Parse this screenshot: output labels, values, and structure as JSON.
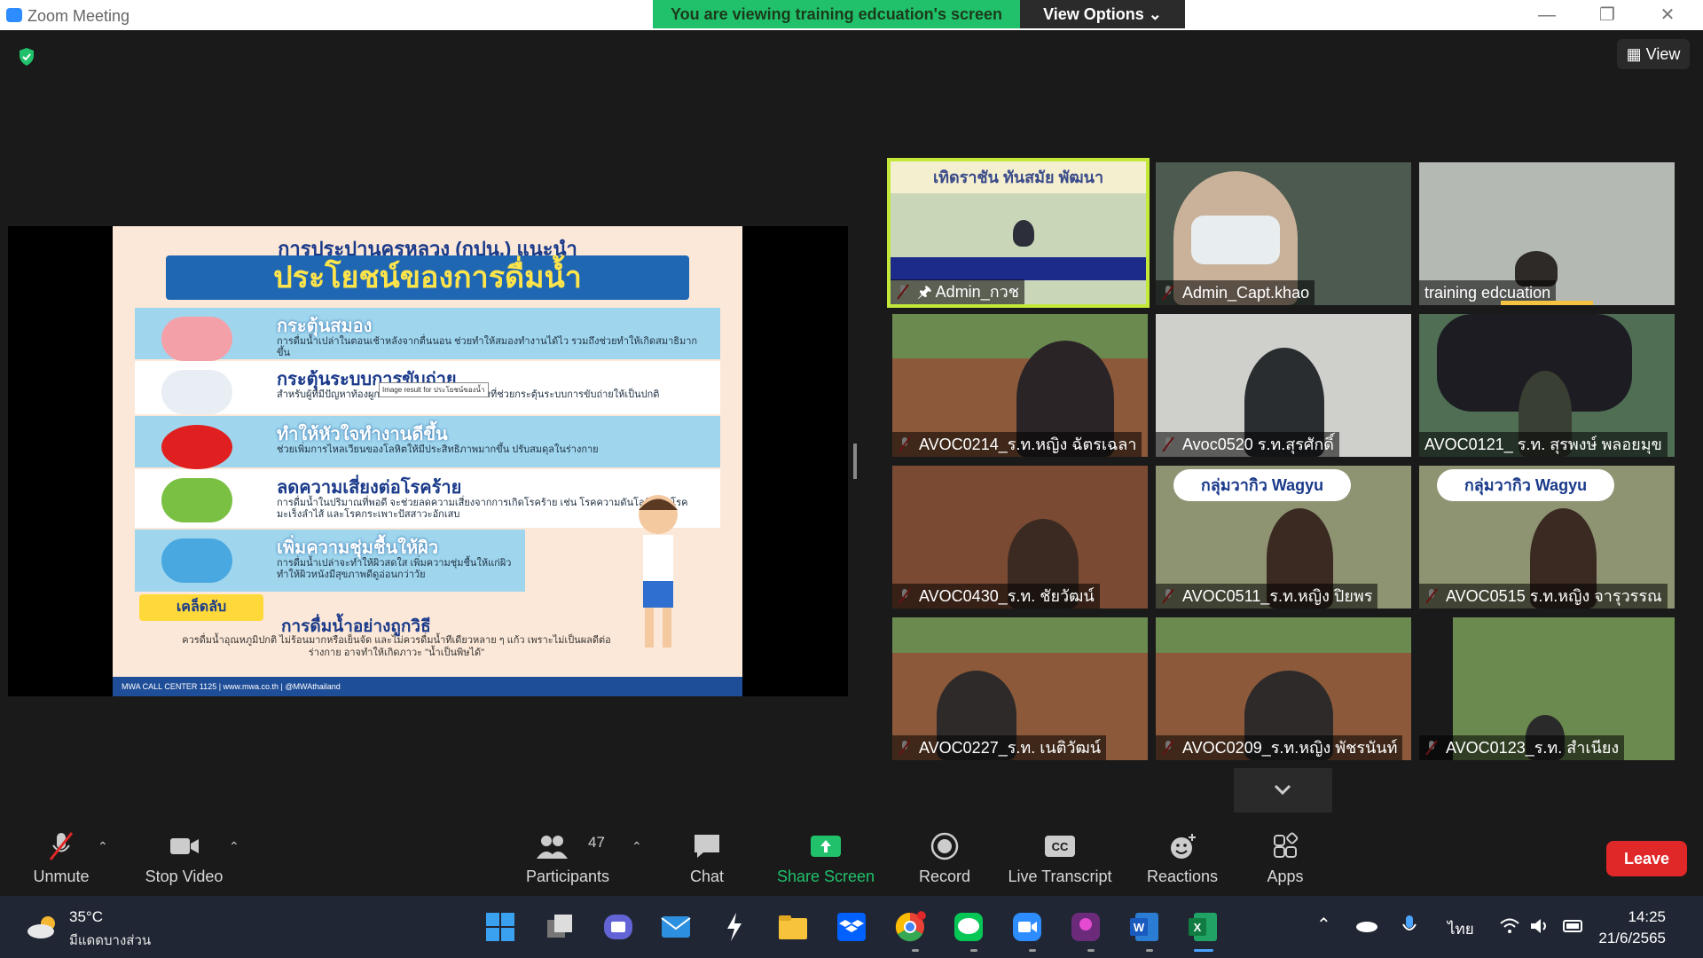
{
  "window": {
    "title": "Zoom Meeting",
    "banner": "You are viewing training edcuation's screen",
    "view_options": "View Options",
    "view_button": "View"
  },
  "poster": {
    "top": "การประปานครหลวง (กปน.) แนะนำ",
    "ribbon": "ประโยชน์ของการดื่มน้ำ",
    "rows": [
      {
        "title": "กระตุ้นสมอง",
        "desc": "การดื่มน้ำเปล่าในตอนเช้าหลังจากตื่นนอน ช่วยทำให้สมองทำงานได้ไว รวมถึงช่วยทำให้เกิดสมาธิมากขึ้น"
      },
      {
        "title": "กระตุ้นระบบการขับถ่าย",
        "desc": "สำหรับผู้ที่มีปัญหาท้องผูก การดื่มน้ำเปล่าเป็นวิธีหนึ่งที่ช่วยกระตุ้นระบบการขับถ่ายให้เป็นปกติ"
      },
      {
        "title": "ทำให้หัวใจทำงานดีขึ้น",
        "desc": "ช่วยเพิ่มการไหลเวียนของโลหิตให้มีประสิทธิภาพมากขึ้น ปรับสมดุลในร่างกาย"
      },
      {
        "title": "ลดความเสี่ยงต่อโรคร้าย",
        "desc": "การดื่มน้ำในปริมาณที่พอดี จะช่วยลดความเสี่ยงจากการเกิดโรคร้าย เช่น โรคความดันโลหิตสูง โรคมะเร็งลำไส้ และโรคกระเพาะปัสสาวะอักเสบ"
      },
      {
        "title": "เพิ่มความชุ่มชื้นให้ผิว",
        "desc": "การดื่มน้ำเปล่าจะทำให้ผิวสดใส เพิ่มความชุ่มชื้นให้แก่ผิว ทำให้ผิวหนังมีสุขภาพดีดูอ่อนกว่าวัย"
      }
    ],
    "tag": "เคล็ดลับ",
    "bottom_title": "การดื่มน้ำอย่างถูกวิธี",
    "bottom_text": "ควรดื่มน้ำอุณหภูมิปกติ ไม่ร้อนมากหรือเย็นจัด และไม่ควรดื่มน้ำทีเดียวหลาย ๆ แก้ว เพราะไม่เป็นผลดีต่อร่างกาย อาจทำให้เกิดภาวะ \"น้ำเป็นพิษได้\"",
    "footer": "MWA CALL CENTER 1125 | www.mwa.co.th | @MWAthailand",
    "tooltip": "Image result for ประโยชน์ของน้ำ"
  },
  "participants": [
    {
      "name": "Admin_กวช",
      "active": true,
      "bg": "#c9d6b8",
      "overlay": "เทิดราชัน ทันสมัย พัฒนา"
    },
    {
      "name": "Admin_Capt.khao",
      "bg": "#4d5a4f"
    },
    {
      "name": "training edcuation",
      "bg": "#9ea6a0"
    },
    {
      "name": "AVOC0214_ร.ท.หญิง ฉัตรเฉลา",
      "bg": "#8c5a3a"
    },
    {
      "name": "Avoc0520 ร.ท.สุรศักดิ์",
      "bg": "#c9c9c4"
    },
    {
      "name": "AVOC0121_ ร.ท. สุรพงษ์  พลอยมุข",
      "bg": "#4f6e54"
    },
    {
      "name": "AVOC0430_ร.ท. ชัยวัฒน์",
      "bg": "#7a4a33"
    },
    {
      "name": "AVOC0511_ร.ท.หญิง ปิยพร",
      "bg": "#8e9472",
      "overlay": "กลุ่มวากิว Wagyu"
    },
    {
      "name": "AVOC0515 ร.ท.หญิง จารุวรรณ",
      "bg": "#8e9472",
      "overlay": "กลุ่มวากิว Wagyu"
    },
    {
      "name": "AVOC0227_ร.ท. เนติวัฒน์",
      "bg": "#8c5a3a"
    },
    {
      "name": "AVOC0209_ร.ท.หญิง พัชรนันท์",
      "bg": "#8c5a3a"
    },
    {
      "name": "AVOC0123_ร.ท. สำเนียง",
      "bg": "#6b8a4f"
    }
  ],
  "toolbar": {
    "unmute": "Unmute",
    "stop_video": "Stop Video",
    "participants": "Participants",
    "participants_count": "47",
    "chat": "Chat",
    "share_screen": "Share Screen",
    "record": "Record",
    "live_transcript": "Live Transcript",
    "reactions": "Reactions",
    "apps": "Apps",
    "leave": "Leave"
  },
  "taskbar": {
    "weather_temp": "35°C",
    "weather_desc": "มีแดดบางส่วน",
    "lang": "ไทย",
    "time": "14:25",
    "date": "21/6/2565"
  }
}
